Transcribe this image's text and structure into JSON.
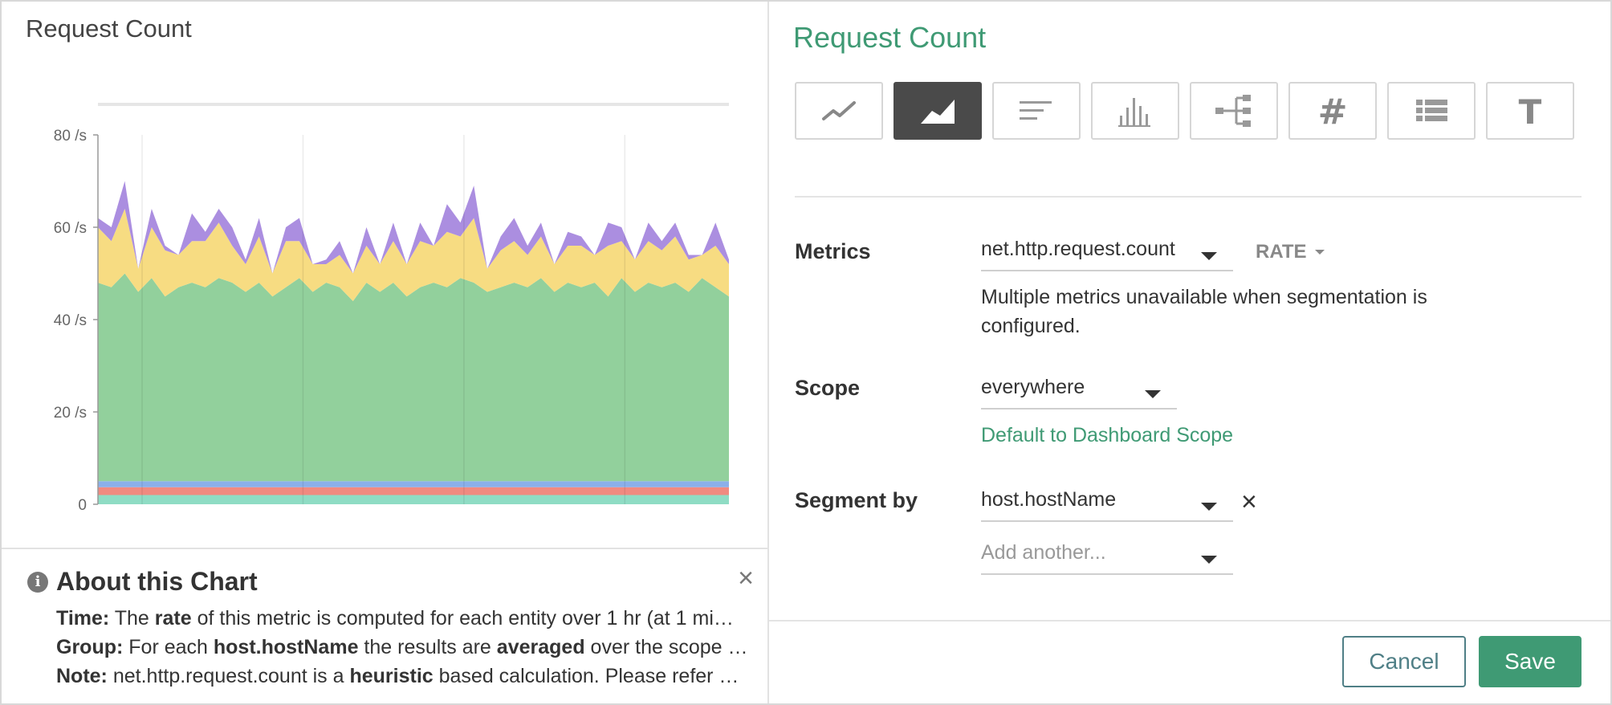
{
  "chart": {
    "title": "Request Count"
  },
  "chart_data": {
    "type": "area",
    "stacked": true,
    "ylim": [
      0,
      80
    ],
    "y_ticks": [
      "0",
      "20 /s",
      "40 /s",
      "60 /s",
      "80 /s"
    ],
    "grid": true,
    "x_points": 48,
    "series": [
      {
        "color": "#8fdcc4",
        "values": [
          2,
          2,
          2,
          2,
          2,
          2,
          2,
          2,
          2,
          2,
          2,
          2,
          2,
          2,
          2,
          2,
          2,
          2,
          2,
          2,
          2,
          2,
          2,
          2,
          2,
          2,
          2,
          2,
          2,
          2,
          2,
          2,
          2,
          2,
          2,
          2,
          2,
          2,
          2,
          2,
          2,
          2,
          2,
          2,
          2,
          2,
          2,
          2
        ]
      },
      {
        "color": "#f08a80",
        "values": [
          1.7,
          1.7,
          1.7,
          1.7,
          1.7,
          1.7,
          1.7,
          1.7,
          1.7,
          1.7,
          1.7,
          1.7,
          1.7,
          1.7,
          1.7,
          1.7,
          1.7,
          1.7,
          1.7,
          1.7,
          1.7,
          1.7,
          1.7,
          1.7,
          1.7,
          1.7,
          1.7,
          1.7,
          1.7,
          1.7,
          1.7,
          1.7,
          1.7,
          1.7,
          1.7,
          1.7,
          1.7,
          1.7,
          1.7,
          1.7,
          1.7,
          1.7,
          1.7,
          1.7,
          1.7,
          1.7,
          1.7,
          1.7
        ]
      },
      {
        "color": "#8ab0ea",
        "values": [
          1.3,
          1.3,
          1.3,
          1.3,
          1.3,
          1.3,
          1.3,
          1.3,
          1.3,
          1.3,
          1.3,
          1.3,
          1.3,
          1.3,
          1.3,
          1.3,
          1.3,
          1.3,
          1.3,
          1.3,
          1.3,
          1.3,
          1.3,
          1.3,
          1.3,
          1.3,
          1.3,
          1.3,
          1.3,
          1.3,
          1.3,
          1.3,
          1.3,
          1.3,
          1.3,
          1.3,
          1.3,
          1.3,
          1.3,
          1.3,
          1.3,
          1.3,
          1.3,
          1.3,
          1.3,
          1.3,
          1.3,
          1.3
        ]
      },
      {
        "color": "#92d09c",
        "values": [
          43,
          42,
          45,
          41,
          44,
          40,
          42,
          43,
          42,
          44,
          43,
          41,
          43,
          40,
          42,
          44,
          41,
          43,
          42,
          39,
          43,
          41,
          43,
          40,
          42,
          43,
          42,
          44,
          43,
          41,
          42,
          43,
          42,
          44,
          41,
          43,
          42,
          43,
          40,
          44,
          41,
          43,
          42,
          43,
          41,
          44,
          42,
          40
        ]
      },
      {
        "color": "#f7dc82",
        "values": [
          12,
          10,
          14,
          5,
          11,
          10,
          7,
          9,
          10,
          12,
          8,
          6,
          10,
          5,
          10,
          8,
          6,
          4,
          7,
          6,
          8,
          6,
          9,
          7,
          10,
          8,
          12,
          9,
          14,
          5,
          8,
          9,
          7,
          9,
          6,
          8,
          9,
          6,
          11,
          8,
          7,
          9,
          8,
          10,
          7,
          5,
          9,
          7
        ]
      },
      {
        "color": "#ab8ee0",
        "values": [
          2,
          3,
          6,
          0,
          4,
          1,
          0,
          6,
          2,
          3,
          4,
          1,
          4,
          0,
          3,
          5,
          0,
          1,
          3,
          0,
          4,
          0,
          4,
          0,
          4,
          0,
          6,
          3,
          7,
          0,
          3,
          5,
          2,
          3,
          0,
          3,
          2,
          0,
          5,
          3,
          0,
          4,
          2,
          3,
          1,
          0,
          5,
          1
        ]
      }
    ]
  },
  "about": {
    "title": "About this Chart",
    "lines": [
      {
        "label": "Time:",
        "parts": [
          " The ",
          "rate",
          " of this metric is computed for each entity over 1 hr (at 1 mi…"
        ]
      },
      {
        "label": "Group:",
        "parts": [
          " For each ",
          "host.hostName",
          " the results are ",
          "averaged",
          " over the scope …"
        ]
      },
      {
        "label": "Note:",
        "parts": [
          " net.http.request.count is a ",
          "heuristic",
          " based calculation. Please refer …"
        ]
      }
    ]
  },
  "editor": {
    "title": "Request Count",
    "chart_types": [
      {
        "icon": "line-chart-icon",
        "active": false
      },
      {
        "icon": "area-chart-icon",
        "active": true
      },
      {
        "icon": "top-list-icon",
        "active": false
      },
      {
        "icon": "histogram-icon",
        "active": false
      },
      {
        "icon": "topology-icon",
        "active": false
      },
      {
        "icon": "number-icon",
        "active": false
      },
      {
        "icon": "table-icon",
        "active": false
      },
      {
        "icon": "text-icon",
        "active": false
      }
    ],
    "metrics_label": "Metrics",
    "metric_value": "net.http.request.count",
    "aggregation": "RATE",
    "metrics_help": "Multiple metrics unavailable when segmentation is configured.",
    "scope_label": "Scope",
    "scope_value": "everywhere",
    "scope_link": "Default to Dashboard Scope",
    "segment_label": "Segment by",
    "segment_value": "host.hostName",
    "segment_placeholder": "Add another...",
    "remove_symbol": "×",
    "cancel_label": "Cancel",
    "save_label": "Save"
  },
  "colors": {
    "accent": "#3f9a74",
    "cancel_border": "#4f7f86"
  }
}
